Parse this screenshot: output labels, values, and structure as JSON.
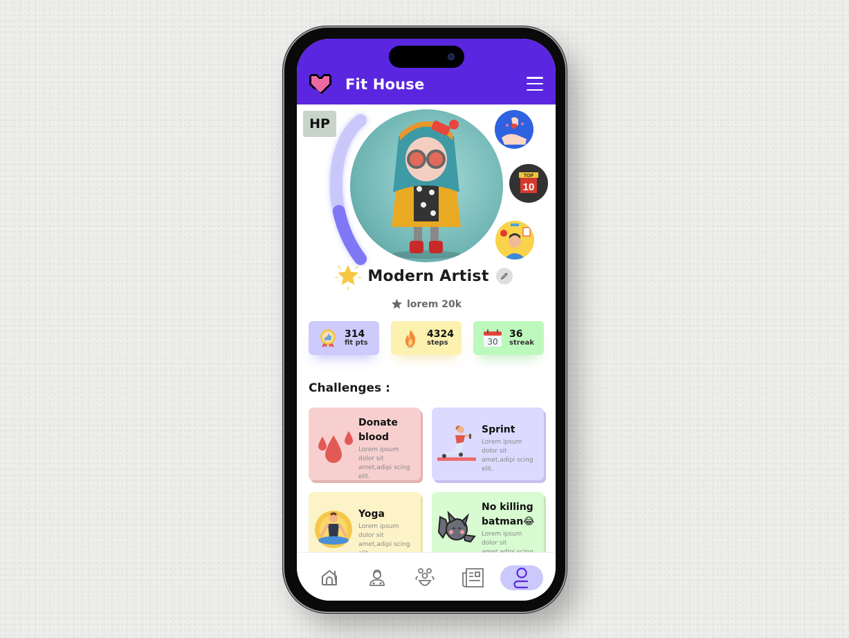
{
  "header": {
    "app_title": "Fit House",
    "logo_icon": "pixel-heart-icon",
    "menu_icon": "hamburger-menu-icon"
  },
  "profile": {
    "hp_label": "HP",
    "hp_level_fraction": 0.35,
    "name": "Modern Artist",
    "rating_text": "lorem 20k",
    "achievement_badges": [
      "donate-heart-badge",
      "top-10-badge",
      "fitness-person-badge"
    ]
  },
  "stats": [
    {
      "value": "314",
      "label": "fit pts",
      "icon": "medal-thumbs-up-icon",
      "color": "#cdcafc"
    },
    {
      "value": "4324",
      "label": "steps",
      "icon": "fire-icon",
      "color": "#fdf1b0"
    },
    {
      "value": "36",
      "label": "streak",
      "icon": "calendar-30-icon",
      "calendar_day": "30",
      "color": "#bdf9bd"
    }
  ],
  "challenges": {
    "title": "Challenges :",
    "items": [
      {
        "title": "Donate blood",
        "desc": "Lorem ipsum dolor sit amet,adipi scing elit.",
        "icon": "blood-drops-icon",
        "color": "#f7cfcf"
      },
      {
        "title": "Sprint",
        "desc": "Lorem ipsum dolor sit amet,adipi scing elit.",
        "icon": "runner-icon",
        "color": "#dcdaff"
      },
      {
        "title": "Yoga",
        "desc": "Lorem ipsum dolor sit amet,adipi scing elit.",
        "icon": "yoga-icon",
        "color": "#fdf3c8"
      },
      {
        "title": "No killing batman😂",
        "desc": "Lorem ipsum dolor sit amet,adipi scing elit.",
        "icon": "bat-icon",
        "color": "#d8fbd2"
      }
    ]
  },
  "bottom_nav": [
    {
      "name": "home",
      "icon": "home-icon",
      "active": false
    },
    {
      "name": "doctor",
      "icon": "doctor-icon",
      "active": false
    },
    {
      "name": "community",
      "icon": "group-icon",
      "active": false
    },
    {
      "name": "news",
      "icon": "newspaper-icon",
      "active": false
    },
    {
      "name": "profile",
      "icon": "user-icon",
      "active": true
    }
  ],
  "colors": {
    "brand": "#5a26e0",
    "active_nav": "#cbc8fb",
    "active_icon": "#5a26e0"
  }
}
